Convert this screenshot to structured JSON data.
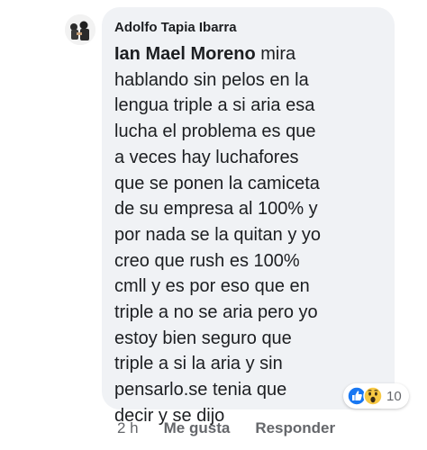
{
  "comment": {
    "author": "Adolfo Tapia Ibarra",
    "mention": "Ian Mael Moreno",
    "lines": [
      " mira",
      "hablando sin pelos en la",
      "lengua triple a si aria esa",
      "lucha el problema es que",
      "a veces hay luchafores",
      "que se ponen la camiceta",
      "de su empresa al 100% y",
      "por nada se la quitan y yo",
      "creo que rush es 100%",
      "cmll y es por eso que en",
      "triple a no se aria pero yo",
      "estoy bien seguro que",
      "triple a si la aria y sin",
      "pensarlo.se tenia que",
      "decir y se dijo"
    ]
  },
  "reactions": {
    "icons": [
      "like-icon",
      "wow-icon"
    ],
    "count": "10"
  },
  "actions": {
    "timestamp": "2 h",
    "like_label": "Me gusta",
    "reply_label": "Responder"
  },
  "colors": {
    "bubble": "#f0f2f5",
    "text": "#1c1e21",
    "secondary_text": "#65676b",
    "like_blue": "#1877f2",
    "wow_yellow": "#f7c843"
  }
}
